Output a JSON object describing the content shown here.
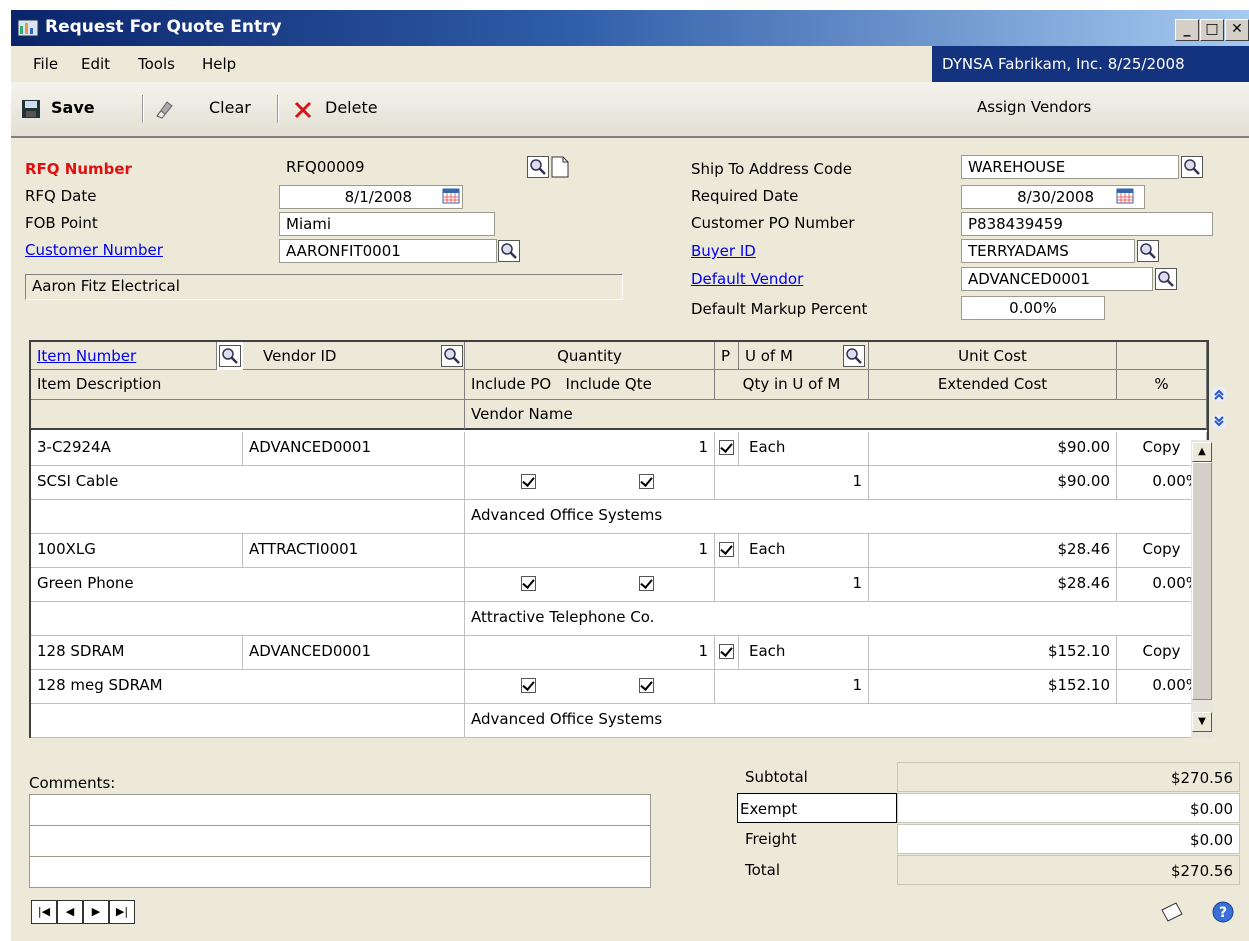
{
  "window": {
    "title": "Request For Quote Entry",
    "min": "_",
    "max": "□",
    "close": "✕"
  },
  "menu": {
    "file": "File",
    "edit": "Edit",
    "tools": "Tools",
    "help": "Help",
    "company": "DYNSA  Fabrikam, Inc.  8/25/2008"
  },
  "toolbar": {
    "save": "Save",
    "clear": "Clear",
    "delete": "Delete",
    "assign_vendors": "Assign Vendors"
  },
  "header": {
    "rfq_number_label": "RFQ Number",
    "rfq_number": "RFQ00009",
    "rfq_date_label": "RFQ Date",
    "rfq_date": "8/1/2008",
    "fob_point_label": "FOB Point",
    "fob_point": "Miami",
    "customer_number_label": "Customer Number",
    "customer_number": "AARONFIT0001",
    "customer_name": "Aaron Fitz Electrical",
    "ship_to_label": "Ship To Address Code",
    "ship_to": "WAREHOUSE",
    "required_date_label": "Required Date",
    "required_date": "8/30/2008",
    "customer_po_label": "Customer PO Number",
    "customer_po": "P838439459",
    "buyer_id_label": "Buyer ID",
    "buyer_id": "TERRYADAMS",
    "default_vendor_label": "Default Vendor",
    "default_vendor": "ADVANCED0001",
    "markup_label": "Default Markup Percent",
    "markup": "0.00%"
  },
  "grid_headers": {
    "item_number": "Item Number",
    "vendor_id": "Vendor ID",
    "quantity": "Quantity",
    "p": "P",
    "u_of_m": "U of M",
    "unit_cost": "Unit Cost",
    "item_description": "Item Description",
    "include_po": "Include PO",
    "include_qte": "Include Qte",
    "qty_in_uofm": "Qty in U of M",
    "extended_cost": "Extended Cost",
    "pct": "%",
    "vendor_name": "Vendor Name"
  },
  "rows": [
    {
      "item": "3-C2924A",
      "vendor_id": "ADVANCED0001",
      "qty": "1",
      "uofm": "Each",
      "unit_cost": "$90.00",
      "copy": "Copy",
      "desc": "SCSI Cable",
      "qty_uofm": "1",
      "ext_cost": "$90.00",
      "pct": "0.00%",
      "vendor_name": "Advanced Office Systems"
    },
    {
      "item": "100XLG",
      "vendor_id": "ATTRACTI0001",
      "qty": "1",
      "uofm": "Each",
      "unit_cost": "$28.46",
      "copy": "Copy",
      "desc": "Green Phone",
      "qty_uofm": "1",
      "ext_cost": "$28.46",
      "pct": "0.00%",
      "vendor_name": "Attractive Telephone Co."
    },
    {
      "item": "128 SDRAM",
      "vendor_id": "ADVANCED0001",
      "qty": "1",
      "uofm": "Each",
      "unit_cost": "$152.10",
      "copy": "Copy",
      "desc": "128 meg SDRAM",
      "qty_uofm": "1",
      "ext_cost": "$152.10",
      "pct": "0.00%",
      "vendor_name": "Advanced Office Systems"
    }
  ],
  "footer": {
    "comments_label": "Comments:",
    "subtotal_label": "Subtotal",
    "subtotal": "$270.56",
    "tax_label": "Exempt",
    "tax": "$0.00",
    "freight_label": "Freight",
    "freight": "$0.00",
    "total_label": "Total",
    "total": "$270.56"
  },
  "colors": {
    "title_bar": "#0a246a",
    "company_bg": "#14337e",
    "required_label": "#e01010",
    "link": "#0000ee"
  }
}
